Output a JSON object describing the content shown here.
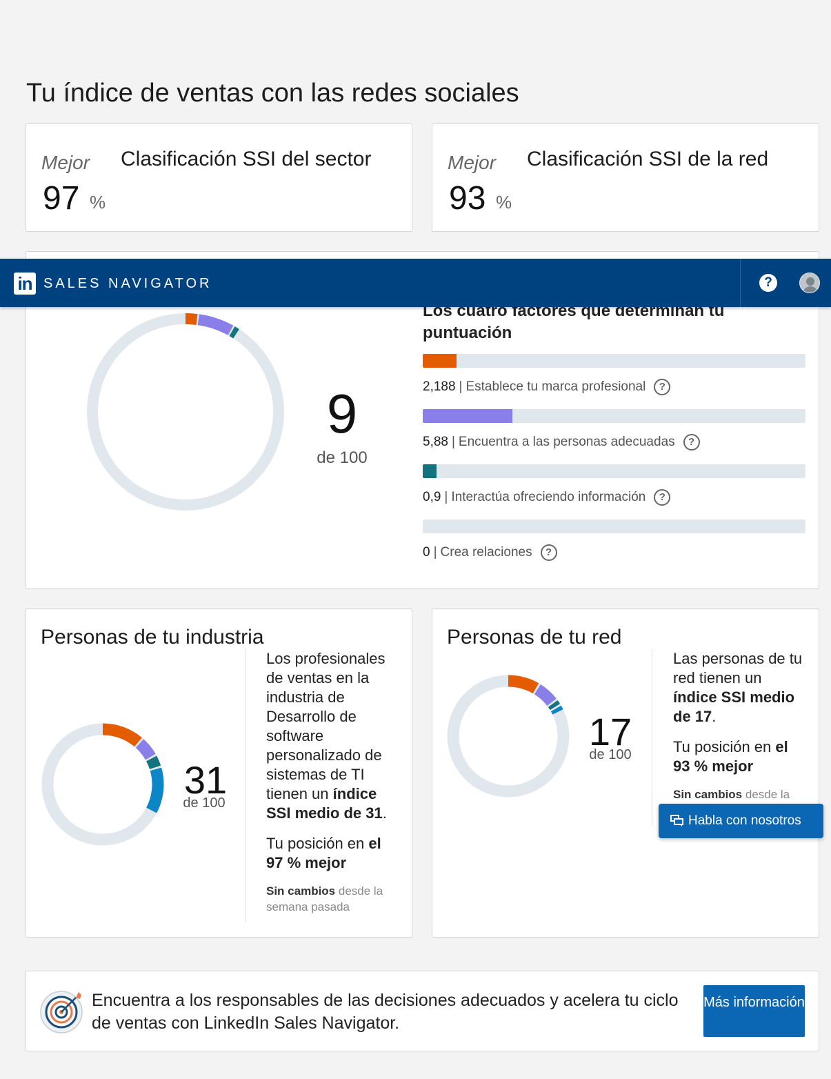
{
  "page": {
    "title": "Tu índice de ventas con las redes sociales"
  },
  "rank_cards": [
    {
      "label": "Mejor",
      "value": "97",
      "unit": "%",
      "title": "Clasificación SSI del sector"
    },
    {
      "label": "Mejor",
      "value": "93",
      "unit": "%",
      "title": "Clasificación SSI de la red"
    }
  ],
  "navbar": {
    "logo": "in",
    "brand": "SALES NAVIGATOR",
    "help_label": "?"
  },
  "ssi": {
    "score": "9",
    "score_suffix": "de 100",
    "factors_title": "Los cuatro factores que determinan tu puntuación",
    "factors": [
      {
        "value": "2,188",
        "label": "Establece tu marca profesional",
        "fraction": 0.0875,
        "color": "#e45c00"
      },
      {
        "value": "5,88",
        "label": "Encuentra a las personas adecuadas",
        "fraction": 0.235,
        "color": "#8a7fe8"
      },
      {
        "value": "0,9",
        "label": "Interactúa ofreciendo información",
        "fraction": 0.036,
        "color": "#13747f"
      },
      {
        "value": "0",
        "label": "Crea relaciones",
        "fraction": 0.0,
        "color": "#0d86c8"
      }
    ]
  },
  "industry": {
    "title": "Personas de tu industria",
    "score": "31",
    "score_suffix": "de 100",
    "text_before": "Los profesionales de ventas en la industria de Desarrollo de software personalizado de sistemas de TI tienen un ",
    "text_bold": "índice SSI medio de 31",
    "text_after": ".",
    "position_before": "Tu posición en ",
    "position_bold": "el 97 % mejor",
    "change_bold": "Sin cambios",
    "change_rest": " desde la semana pasada"
  },
  "network": {
    "title": "Personas de tu red",
    "score": "17",
    "score_suffix": "de 100",
    "text_before": "Las personas de tu red tienen un ",
    "text_bold": "índice SSI medio de 17",
    "text_after": ".",
    "position_before": "Tu posición en ",
    "position_bold": "el 93 % mejor",
    "change_bold": "Sin cambios",
    "change_rest": " desde la"
  },
  "chat": {
    "label": "Habla con nosotros"
  },
  "promo": {
    "text": "Encuentra a los responsables de las decisiones adecuados y acelera tu ciclo de ventas con LinkedIn Sales Navigator.",
    "button": "Más información"
  },
  "colors": {
    "brand_profesional": "#e45c00",
    "personas": "#8a7fe8",
    "interactua": "#13747f",
    "relaciones": "#0d86c8",
    "track": "#e1e8ed",
    "navbar": "#00427f",
    "button": "#0b66b4"
  },
  "icons": [
    "help-icon",
    "avatar-icon",
    "question-icon",
    "chat-icon",
    "target-icon"
  ]
}
